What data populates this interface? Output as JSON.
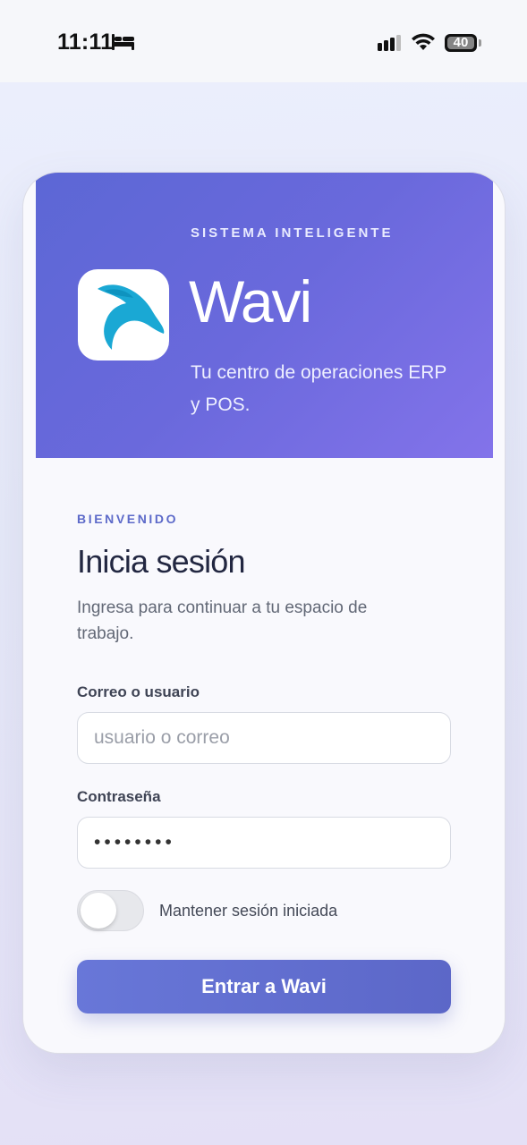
{
  "status_bar": {
    "time": "11:11",
    "battery": "40",
    "icons": [
      "bed-icon",
      "cellular-signal-icon",
      "wifi-icon",
      "battery-icon"
    ]
  },
  "hero": {
    "eyebrow": "SISTEMA INTELIGENTE",
    "app_name": "Wavi",
    "subtitle": "Tu centro de operaciones ERP y POS.",
    "logo_icon": "dolphin-logo",
    "gradient": [
      "#5c67d5",
      "#8373ea"
    ]
  },
  "login": {
    "welcome": "BIENVENIDO",
    "title": "Inicia sesión",
    "description": "Ingresa para continuar a tu espacio de trabajo.",
    "user_label": "Correo o usuario",
    "user_placeholder": "usuario o correo",
    "password_label": "Contraseña",
    "password_value": "••••••••",
    "remember_label": "Mantener sesión iniciada",
    "remember_checked": false,
    "submit_label": "Entrar a Wavi"
  },
  "colors": {
    "accent": "#5d6ac9",
    "logo_teal": "#1aa8d4",
    "title_text": "#222741"
  }
}
